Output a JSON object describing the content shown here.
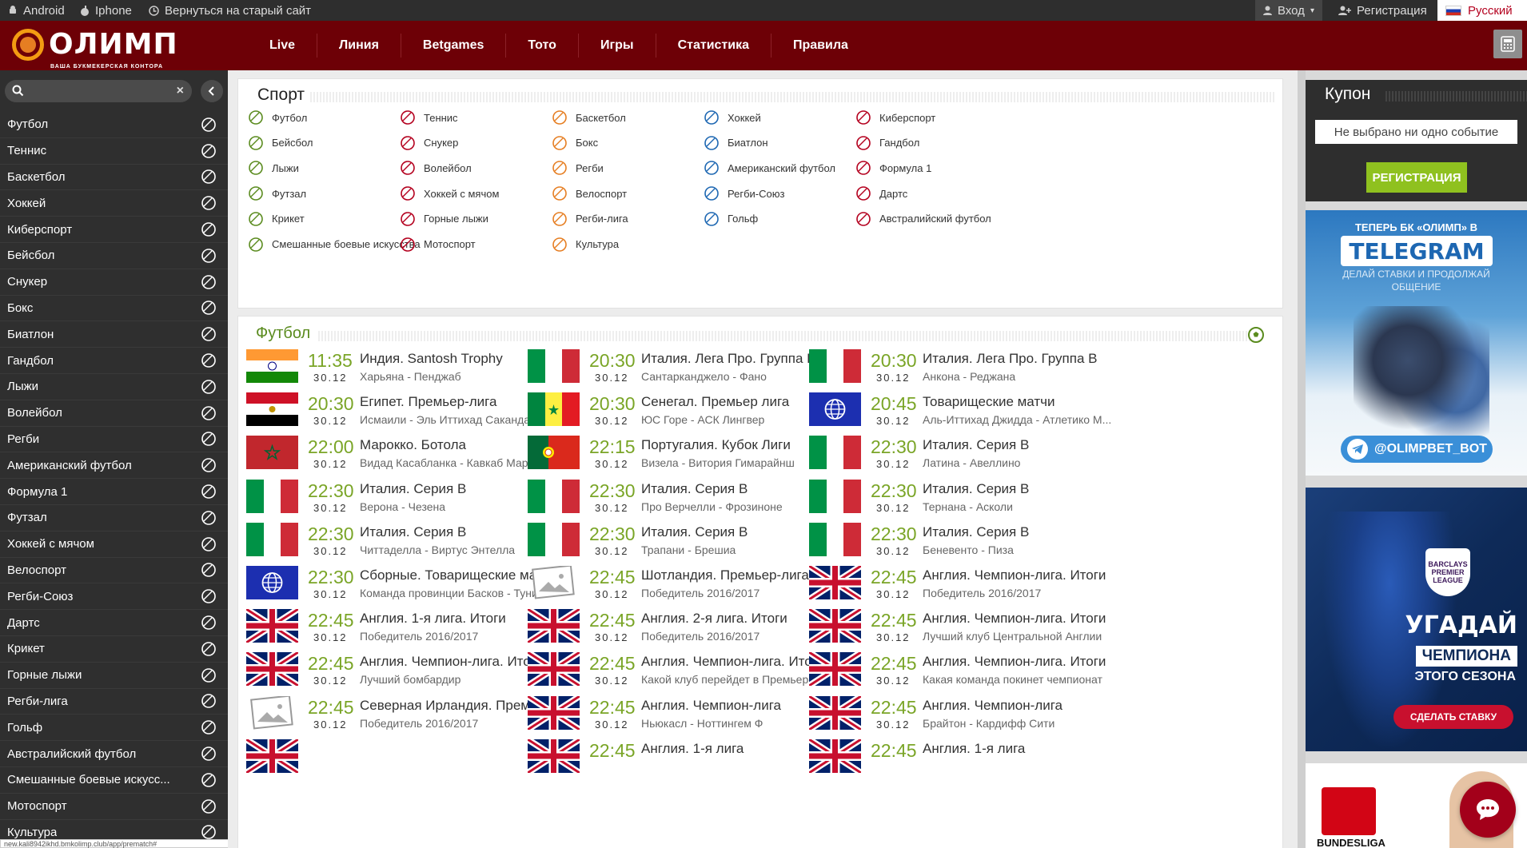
{
  "topbar": {
    "android": "Android",
    "iphone": "Iphone",
    "old_site": "Вернуться на старый сайт",
    "login": "Вход",
    "register": "Регистрация",
    "language": "Русский"
  },
  "brand": {
    "name": "ОЛИМП",
    "tagline": "ВАША БУКМЕКЕРСКАЯ КОНТОРА"
  },
  "nav": [
    "Live",
    "Линия",
    "Betgames",
    "Тото",
    "Игры",
    "Статистика",
    "Правила"
  ],
  "search": {
    "placeholder": "",
    "value": ""
  },
  "sidebar": [
    "Футбол",
    "Теннис",
    "Баскетбол",
    "Хоккей",
    "Киберспорт",
    "Бейсбол",
    "Снукер",
    "Бокс",
    "Биатлон",
    "Гандбол",
    "Лыжи",
    "Волейбол",
    "Регби",
    "Американский футбол",
    "Формула 1",
    "Футзал",
    "Хоккей с мячом",
    "Велоспорт",
    "Регби-Союз",
    "Дартс",
    "Крикет",
    "Горные лыжи",
    "Регби-лига",
    "Гольф",
    "Австралийский футбол",
    "Смешанные боевые искусс...",
    "Мотоспорт",
    "Культура"
  ],
  "sport_panel": {
    "title": "Спорт",
    "columns": [
      [
        "Футбол",
        "Бейсбол",
        "Лыжи",
        "Футзал",
        "Крикет",
        "Смешанные боевые искусства"
      ],
      [
        "Теннис",
        "Снукер",
        "Волейбол",
        "Хоккей с мячом",
        "Горные лыжи",
        "Мотоспорт"
      ],
      [
        "Баскетбол",
        "Бокс",
        "Регби",
        "Велоспорт",
        "Регби-лига",
        "Культура"
      ],
      [
        "Хоккей",
        "Биатлон",
        "Американский футбол",
        "Регби-Союз",
        "Гольф"
      ],
      [
        "Киберспорт",
        "Гандбол",
        "Формула 1",
        "Дартс",
        "Австралийский футбол"
      ]
    ]
  },
  "events_panel": {
    "title": "Футбол",
    "rows": [
      [
        {
          "flag": "india",
          "time": "11:35",
          "date": "30.12",
          "name": "Индия. Santosh Trophy",
          "sub": "Харьяна - Пенджаб"
        },
        {
          "flag": "italy",
          "time": "20:30",
          "date": "30.12",
          "name": "Италия. Лега Про. Группа В",
          "sub": "Сантарканджело - Фано"
        },
        {
          "flag": "italy",
          "time": "20:30",
          "date": "30.12",
          "name": "Италия. Лега Про. Группа В",
          "sub": "Анкона - Реджана"
        }
      ],
      [
        {
          "flag": "egypt",
          "time": "20:30",
          "date": "30.12",
          "name": "Египет. Премьер-лига",
          "sub": "Исмаили - Эль Иттихад Сакандари"
        },
        {
          "flag": "senegal",
          "time": "20:30",
          "date": "30.12",
          "name": "Сенегал. Премьер лига",
          "sub": "ЮС Горе - АСК Лингвер"
        },
        {
          "flag": "world",
          "time": "20:45",
          "date": "30.12",
          "name": "Товарищеские матчи",
          "sub": "Аль-Иттихад Джидда - Атлетико М..."
        }
      ],
      [
        {
          "flag": "morocco",
          "time": "22:00",
          "date": "30.12",
          "name": "Марокко. Ботола",
          "sub": "Видад Касабланка - Кавкаб Марра..."
        },
        {
          "flag": "portugal",
          "time": "22:15",
          "date": "30.12",
          "name": "Португалия. Кубок Лиги",
          "sub": "Визела - Витория Гимарайнш"
        },
        {
          "flag": "italy",
          "time": "22:30",
          "date": "30.12",
          "name": "Италия. Серия В",
          "sub": "Латина - Авеллино"
        }
      ],
      [
        {
          "flag": "italy",
          "time": "22:30",
          "date": "30.12",
          "name": "Италия. Серия В",
          "sub": "Верона - Чезена"
        },
        {
          "flag": "italy",
          "time": "22:30",
          "date": "30.12",
          "name": "Италия. Серия В",
          "sub": "Про Верчелли - Фрозиноне"
        },
        {
          "flag": "italy",
          "time": "22:30",
          "date": "30.12",
          "name": "Италия. Серия В",
          "sub": "Тернана - Асколи"
        }
      ],
      [
        {
          "flag": "italy",
          "time": "22:30",
          "date": "30.12",
          "name": "Италия. Серия В",
          "sub": "Читтаделла - Виртус Энтелла"
        },
        {
          "flag": "italy",
          "time": "22:30",
          "date": "30.12",
          "name": "Италия. Серия В",
          "sub": "Трапани - Брешиа"
        },
        {
          "flag": "italy",
          "time": "22:30",
          "date": "30.12",
          "name": "Италия. Серия В",
          "sub": "Беневенто - Пиза"
        }
      ],
      [
        {
          "flag": "world",
          "time": "22:30",
          "date": "30.12",
          "name": "Сборные. Товарищеские ма...",
          "sub": "Команда провинции Басков - Тунис"
        },
        {
          "flag": "placeholder",
          "time": "22:45",
          "date": "30.12",
          "name": "Шотландия. Премьер-лига. ...",
          "sub": "Победитель 2016/2017"
        },
        {
          "flag": "uk",
          "time": "22:45",
          "date": "30.12",
          "name": "Англия. Чемпион-лига. Итоги",
          "sub": "Победитель 2016/2017"
        }
      ],
      [
        {
          "flag": "uk",
          "time": "22:45",
          "date": "30.12",
          "name": "Англия. 1-я лига. Итоги",
          "sub": "Победитель 2016/2017"
        },
        {
          "flag": "uk",
          "time": "22:45",
          "date": "30.12",
          "name": "Англия. 2-я лига. Итоги",
          "sub": "Победитель 2016/2017"
        },
        {
          "flag": "uk",
          "time": "22:45",
          "date": "30.12",
          "name": "Англия. Чемпион-лига. Итоги",
          "sub": "Лучший клуб Центральной Англии"
        }
      ],
      [
        {
          "flag": "uk",
          "time": "22:45",
          "date": "30.12",
          "name": "Англия. Чемпион-лига. Итоги",
          "sub": "Лучший бомбардир"
        },
        {
          "flag": "uk",
          "time": "22:45",
          "date": "30.12",
          "name": "Англия. Чемпион-лига. Итоги",
          "sub": "Какой клуб перейдет в Премьер-ли..."
        },
        {
          "flag": "uk",
          "time": "22:45",
          "date": "30.12",
          "name": "Англия. Чемпион-лига. Итоги",
          "sub": "Какая команда покинет чемпионат"
        }
      ],
      [
        {
          "flag": "placeholder",
          "time": "22:45",
          "date": "30.12",
          "name": "Северная Ирландия. Премье...",
          "sub": "Победитель 2016/2017"
        },
        {
          "flag": "uk",
          "time": "22:45",
          "date": "30.12",
          "name": "Англия. Чемпион-лига",
          "sub": "Ньюкасл - Ноттингем Ф"
        },
        {
          "flag": "uk",
          "time": "22:45",
          "date": "30.12",
          "name": "Англия. Чемпион-лига",
          "sub": "Брайтон - Кардифф Сити"
        }
      ],
      [
        {
          "flag": "uk",
          "time": "",
          "date": "",
          "name": "",
          "sub": ""
        },
        {
          "flag": "uk",
          "time": "22:45",
          "date": "",
          "name": "Англия. 1-я лига",
          "sub": ""
        },
        {
          "flag": "uk",
          "time": "22:45",
          "date": "",
          "name": "Англия. 1-я лига",
          "sub": ""
        }
      ]
    ]
  },
  "coupon": {
    "title": "Купон",
    "empty_text": "Не выбрано ни одно событие",
    "register_button": "РЕГИСТРАЦИЯ"
  },
  "banners": {
    "telegram": {
      "top": "ТЕПЕРЬ БК «ОЛИМП» В",
      "big": "TELEGRAM",
      "desc": "ДЕЛАЙ СТАВКИ И ПРОДОЛЖАЙ ОБЩЕНИЕ",
      "bot": "@OLIMPBET_BOT"
    },
    "champion": {
      "badge": "BARCLAYS PREMIER LEAGUE",
      "line1": "УГАДАЙ",
      "line2": "ЧЕМПИОНА",
      "line3": "ЭТОГО СЕЗОНА",
      "button": "СДЕЛАТЬ СТАВКУ"
    },
    "bundesliga": {
      "label": "BUNDESLIGA"
    }
  },
  "status_url": "new.kali8942ikhd.bmkolimp.club/app/prematch#",
  "colors": {
    "brand": "#6d0006",
    "accent_green": "#7aa527",
    "register_green": "#8fc11f"
  }
}
